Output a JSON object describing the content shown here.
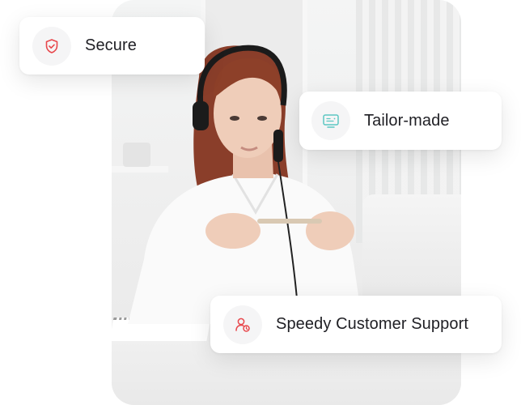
{
  "photo": {
    "description_name": "support-agent-photo"
  },
  "features": {
    "secure": {
      "label": "Secure",
      "icon": "shield-check-icon",
      "icon_color": "#e8474c"
    },
    "tailor": {
      "label": "Tailor-made",
      "icon": "monitor-icon",
      "icon_color": "#5cc7c2"
    },
    "speedy": {
      "label": "Speedy Customer Support",
      "icon": "user-support-icon",
      "icon_color": "#e8474c"
    }
  },
  "colors": {
    "text": "#1f1f24",
    "pill_bg": "#ffffff",
    "icon_bg": "#f5f5f6"
  }
}
